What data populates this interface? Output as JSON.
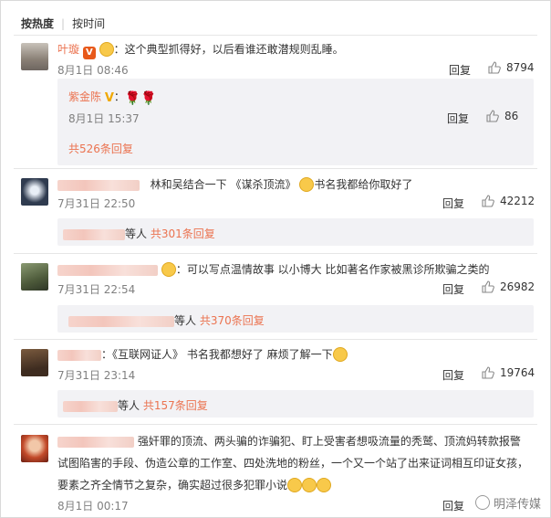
{
  "sort": {
    "hot_label": "按热度",
    "time_label": "按时间"
  },
  "comments": [
    {
      "user": "叶璇",
      "text": "：这个典型抓得好，以后看谁还敢潜规则乱睡。",
      "time": "8月1日 08:46",
      "reply": "回复",
      "likes": "8794"
    },
    {
      "user": "紫金陈",
      "text": "：",
      "time": "8月1日 15:37",
      "reply": "回复",
      "likes": "86",
      "sub_more": "共526条回复"
    },
    {
      "text": "林和吴结合一下 《谋杀顶流》",
      "text2": "书名我都给你取好了",
      "time": "7月31日 22:50",
      "reply": "回复",
      "likes": "42212",
      "sub_suffix": "等人",
      "sub_more": "共301条回复"
    },
    {
      "text": "：可以写点温情故事 以小博大 比如著名作家被黑诊所欺骗之类的",
      "time": "7月31日 22:54",
      "reply": "回复",
      "likes": "26982",
      "sub_suffix": "等人",
      "sub_more": "共370条回复"
    },
    {
      "text": "：《互联网证人》 书名我都想好了 麻烦了解一下",
      "time": "7月31日 23:14",
      "reply": "回复",
      "likes": "19764",
      "sub_suffix": "等人",
      "sub_more": "共157条回复"
    },
    {
      "text_l1": "强奸罪的顶流、两头骗的诈骗犯、盯上受害者想吸流量的秃鹫、顶流妈转款报警",
      "text_l2": "试图陷害的手段、伪造公章的工作室、四处洗地的粉丝，一个又一个站了出来证词相互印证女孩，",
      "text_l3": "要素之齐全情节之复杂，确实超过很多犯罪小说",
      "time": "8月1日 00:17",
      "reply": "回复"
    }
  ],
  "watermark": "明泽传媒"
}
